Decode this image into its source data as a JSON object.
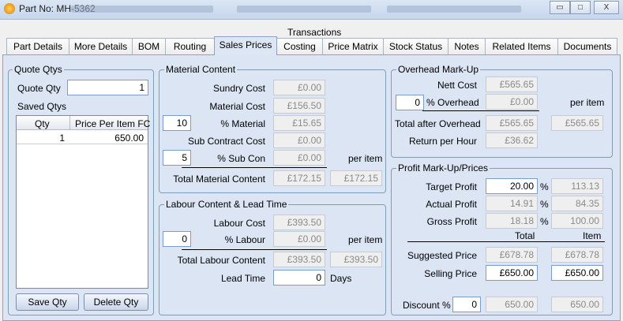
{
  "window": {
    "title": "Part No: MH-5362",
    "minimize": "▭",
    "maximize": "□",
    "close": "X"
  },
  "tabs": {
    "row_top": [
      "Transactions"
    ],
    "items": [
      "Part Details",
      "More Details",
      "BOM",
      "Routing",
      "Sales Prices",
      "Costing",
      "Price Matrix",
      "Stock Status",
      "Notes",
      "Related Items",
      "Documents"
    ],
    "active": "Sales Prices"
  },
  "quote": {
    "title": "Quote Qtys",
    "qty_label": "Quote Qty",
    "qty_value": "1",
    "saved_label": "Saved Qtys",
    "columns": [
      "Qty",
      "Price Per Item FC"
    ],
    "rows": [
      [
        "1",
        "650.00"
      ]
    ],
    "save_btn": "Save Qty",
    "delete_btn": "Delete Qty"
  },
  "material": {
    "title": "Material Content",
    "sundry_label": "Sundry Cost",
    "sundry": "£0.00",
    "material_label": "Material Cost",
    "material": "£156.50",
    "pct_material_input": "10",
    "pct_material_label": "% Material",
    "pct_material": "£15.65",
    "subcon_label": "Sub Contract Cost",
    "subcon": "£0.00",
    "pct_subcon_input": "5",
    "pct_subcon_label": "% Sub Con",
    "pct_subcon": "£0.00",
    "per_item": "per item",
    "total_label": "Total Material Content",
    "total": "£172.15",
    "total_item": "£172.15"
  },
  "labour": {
    "title": "Labour Content & Lead Time",
    "cost_label": "Labour Cost",
    "cost": "£393.50",
    "pct_input": "0",
    "pct_label": "% Labour",
    "pct": "£0.00",
    "per_item": "per item",
    "total_label": "Total Labour Content",
    "total": "£393.50",
    "total_item": "£393.50",
    "lead_label": "Lead Time",
    "lead": "0",
    "days": "Days"
  },
  "overhead": {
    "title": "Overhead Mark-Up",
    "nett_label": "Nett Cost",
    "nett": "£565.65",
    "pct_input": "0",
    "pct_label": "% Overhead",
    "pct": "£0.00",
    "per_item": "per item",
    "total_label": "Total after Overhead",
    "total": "£565.65",
    "total_item": "£565.65",
    "return_label": "Return per Hour",
    "return": "£36.62"
  },
  "profit": {
    "title": "Profit Mark-Up/Prices",
    "target_label": "Target Profit",
    "target": "20.00",
    "target_item": "113.13",
    "actual_label": "Actual Profit",
    "actual": "14.91",
    "actual_item": "84.35",
    "gross_label": "Gross Profit",
    "gross": "18.18",
    "gross_item": "100.00",
    "pct": "%",
    "col_total": "Total",
    "col_item": "Item",
    "suggested_label": "Suggested Price",
    "suggested": "£678.78",
    "suggested_item": "£678.78",
    "selling_label": "Selling Price",
    "selling": "£650.00",
    "selling_item": "£650.00",
    "discount_label": "Discount %",
    "discount": "0",
    "disc_total": "650.00",
    "disc_item": "650.00"
  }
}
